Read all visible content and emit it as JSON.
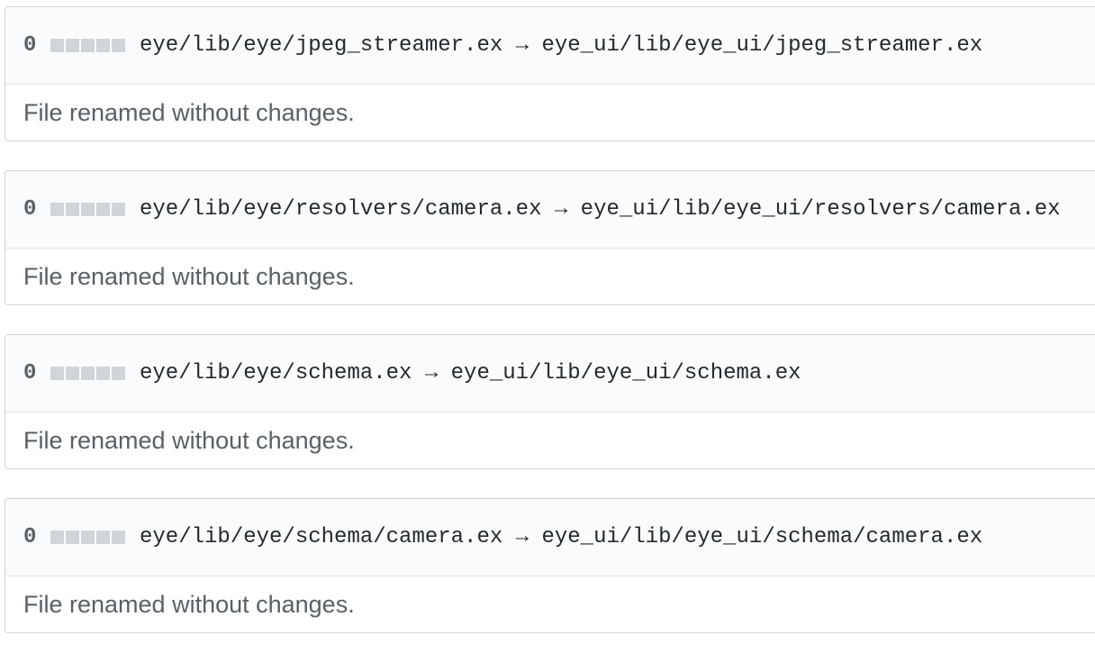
{
  "files": [
    {
      "count": "0",
      "path": "eye/lib/eye/jpeg_streamer.ex → eye_ui/lib/eye_ui/jpeg_streamer.ex",
      "message": "File renamed without changes."
    },
    {
      "count": "0",
      "path": "eye/lib/eye/resolvers/camera.ex → eye_ui/lib/eye_ui/resolvers/camera.ex",
      "message": "File renamed without changes."
    },
    {
      "count": "0",
      "path": "eye/lib/eye/schema.ex → eye_ui/lib/eye_ui/schema.ex",
      "message": "File renamed without changes."
    },
    {
      "count": "0",
      "path": "eye/lib/eye/schema/camera.ex → eye_ui/lib/eye_ui/schema/camera.ex",
      "message": "File renamed without changes."
    }
  ],
  "colors": {
    "diffstat_neutral": "#d1d5da",
    "header_bg": "#fafbfc",
    "border": "#d1d5da",
    "muted_text": "#586069"
  }
}
